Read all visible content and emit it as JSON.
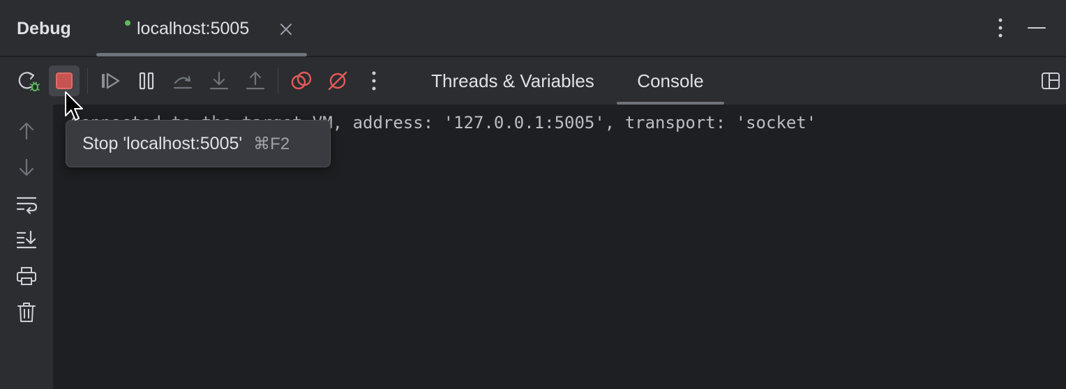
{
  "title_bar": {
    "title": "Debug",
    "session_tab": {
      "label": "localhost:5005",
      "status_color": "#5fb85c",
      "close_icon": "close-icon"
    },
    "more_icon": "more-vertical-icon",
    "minimize_icon": "minimize-icon"
  },
  "toolbar": {
    "buttons": [
      {
        "name": "rerun-debug-button",
        "icon": "rerun-bug-icon"
      },
      {
        "name": "stop-button",
        "icon": "stop-icon",
        "state": "hovered"
      },
      {
        "name": "resume-button",
        "icon": "resume-icon"
      },
      {
        "name": "pause-button",
        "icon": "pause-icon"
      },
      {
        "name": "step-over-button",
        "icon": "step-over-icon"
      },
      {
        "name": "step-into-button",
        "icon": "step-into-icon"
      },
      {
        "name": "step-out-button",
        "icon": "step-out-icon"
      },
      {
        "name": "view-breakpoints-button",
        "icon": "breakpoints-icon"
      },
      {
        "name": "mute-breakpoints-button",
        "icon": "mute-breakpoints-icon"
      },
      {
        "name": "toolbar-more-button",
        "icon": "more-vertical-icon"
      }
    ],
    "tabs": [
      {
        "label": "Threads & Variables",
        "selected": false
      },
      {
        "label": "Console",
        "selected": true
      }
    ],
    "layout_icon": "layout-icon"
  },
  "sidebar": {
    "buttons": [
      {
        "name": "scroll-up-button",
        "icon": "arrow-up-icon"
      },
      {
        "name": "scroll-down-button",
        "icon": "arrow-down-icon"
      },
      {
        "name": "soft-wrap-button",
        "icon": "soft-wrap-icon"
      },
      {
        "name": "scroll-to-end-button",
        "icon": "scroll-to-end-icon"
      },
      {
        "name": "print-button",
        "icon": "print-icon"
      },
      {
        "name": "clear-console-button",
        "icon": "trash-icon"
      }
    ]
  },
  "console": {
    "lines": [
      "Connected to the target VM, address: '127.0.0.1:5005', transport: 'socket'"
    ]
  },
  "tooltip": {
    "text": "Stop 'localhost:5005'",
    "shortcut": "⌘F2"
  },
  "colors": {
    "background": "#1e1f22",
    "panel": "#2b2d30",
    "stop_red": "#db5c5c",
    "breakpoint_red": "#e55a5a",
    "rerun_green": "#5fb85c"
  }
}
